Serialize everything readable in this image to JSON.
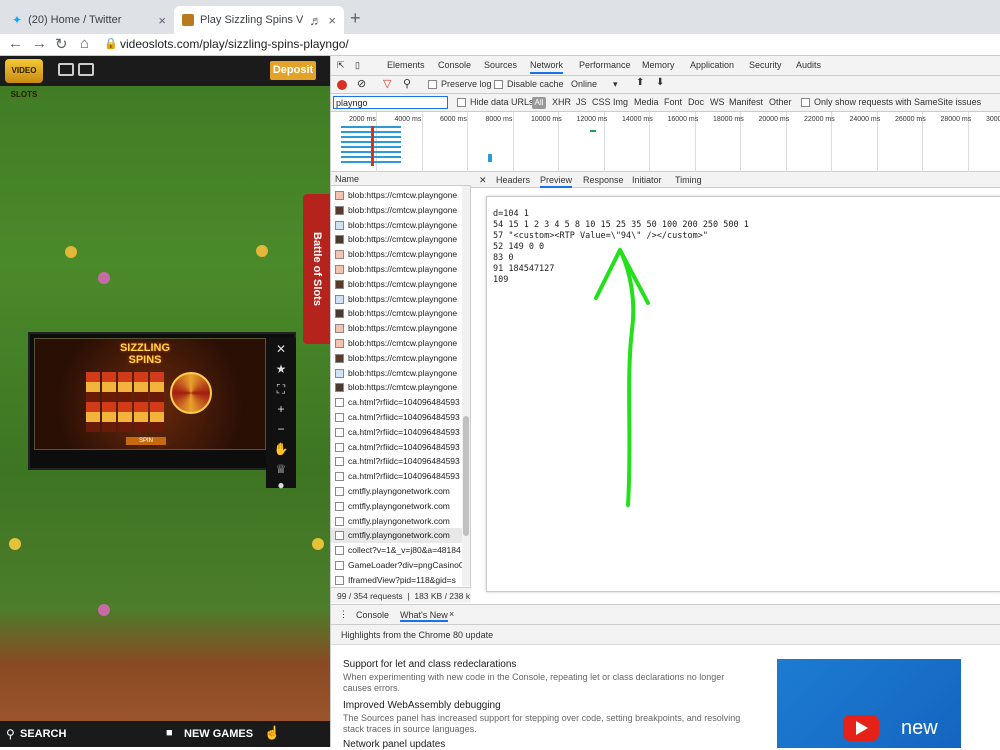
{
  "browser": {
    "tabs": [
      {
        "title": "(20) Home / Twitter",
        "icon": "twitter-icon"
      },
      {
        "title": "Play Sizzling Spins Video Slot",
        "icon": "videoslots-favicon-icon"
      }
    ],
    "url": "videoslots.com/play/sizzling-spins-playngo/"
  },
  "game_page": {
    "logo": "VIDEO SLOTS",
    "deposit_label": "Deposit",
    "battle_label": "Battle of Slots",
    "game_title": "SIZZLING SPINS",
    "spin_label": "SPIN",
    "search_label": "SEARCH",
    "new_games_label": "NEW GAMES"
  },
  "devtools": {
    "panel_tabs": [
      "Elements",
      "Console",
      "Sources",
      "Network",
      "Performance",
      "Memory",
      "Application",
      "Security",
      "Audits"
    ],
    "active_panel": "Network",
    "preserve_log": "Preserve log",
    "disable_cache": "Disable cache",
    "throttle": "Online",
    "filter_value": "playngo",
    "hide_data_urls": "Hide data URLs",
    "type_filters": [
      "All",
      "XHR",
      "JS",
      "CSS",
      "Img",
      "Media",
      "Font",
      "Doc",
      "WS",
      "Manifest",
      "Other"
    ],
    "samesite": "Only show requests with SameSite issues",
    "timeline_ticks": [
      "2000 ms",
      "4000 ms",
      "6000 ms",
      "8000 ms",
      "10000 ms",
      "12000 ms",
      "14000 ms",
      "16000 ms",
      "18000 ms",
      "20000 ms",
      "22000 ms",
      "24000 ms",
      "26000 ms",
      "28000 ms",
      "3000"
    ],
    "name_header": "Name",
    "requests": [
      "blob:https://cmtcw.playngone",
      "blob:https://cmtcw.playngone",
      "blob:https://cmtcw.playngone",
      "blob:https://cmtcw.playngone",
      "blob:https://cmtcw.playngone",
      "blob:https://cmtcw.playngone",
      "blob:https://cmtcw.playngone",
      "blob:https://cmtcw.playngone",
      "blob:https://cmtcw.playngone",
      "blob:https://cmtcw.playngone",
      "blob:https://cmtcw.playngone",
      "blob:https://cmtcw.playngone",
      "blob:https://cmtcw.playngone",
      "blob:https://cmtcw.playngone",
      "ca.html?rfiidc=104096484593",
      "ca.html?rfiidc=104096484593",
      "ca.html?rfiidc=104096484593",
      "ca.html?rfiidc=104096484593",
      "ca.html?rfiidc=104096484593",
      "ca.html?rfiidc=104096484593",
      "cmtfly.playngonetwork.com",
      "cmtfly.playngonetwork.com",
      "cmtfly.playngonetwork.com",
      "cmtfly.playngonetwork.com",
      "collect?v=1&_v=j80&a=48184",
      "GameLoader?div=pngCasinoG",
      "IframedView?pid=118&gid=s"
    ],
    "status": "99 / 354 requests",
    "size": "183 KB / 238 k",
    "detail_tabs": [
      "Headers",
      "Preview",
      "Response",
      "Initiator",
      "Timing"
    ],
    "active_detail": "Preview",
    "preview_lines": [
      "d=104 1",
      "54 15 1 2 3 4 5 8 10 15 25 35 50 100 200 250 500 1",
      "57 \"<custom><RTP Value=\\\"94\\\" /></custom>\"",
      "52 149 0 0",
      "83 0",
      "91 184547127",
      "109"
    ],
    "drawer_tabs": [
      "Console",
      "What's New"
    ],
    "drawer_header": "Highlights from the Chrome 80 update",
    "whats_new": [
      {
        "title": "Support for let and class redeclarations",
        "desc": "When experimenting with new code in the Console, repeating let or class declarations no longer causes errors."
      },
      {
        "title": "Improved WebAssembly debugging",
        "desc": "The Sources panel has increased support for stepping over code, setting breakpoints, and resolving stack traces in source languages."
      },
      {
        "title": "Network panel updates",
        "desc": ""
      }
    ],
    "promo_text": "new"
  },
  "colors": {
    "annotation_arrow": "#22e01a",
    "deposit": "#e5a228",
    "battle": "#b5241c",
    "accent": "#1a73e8"
  }
}
